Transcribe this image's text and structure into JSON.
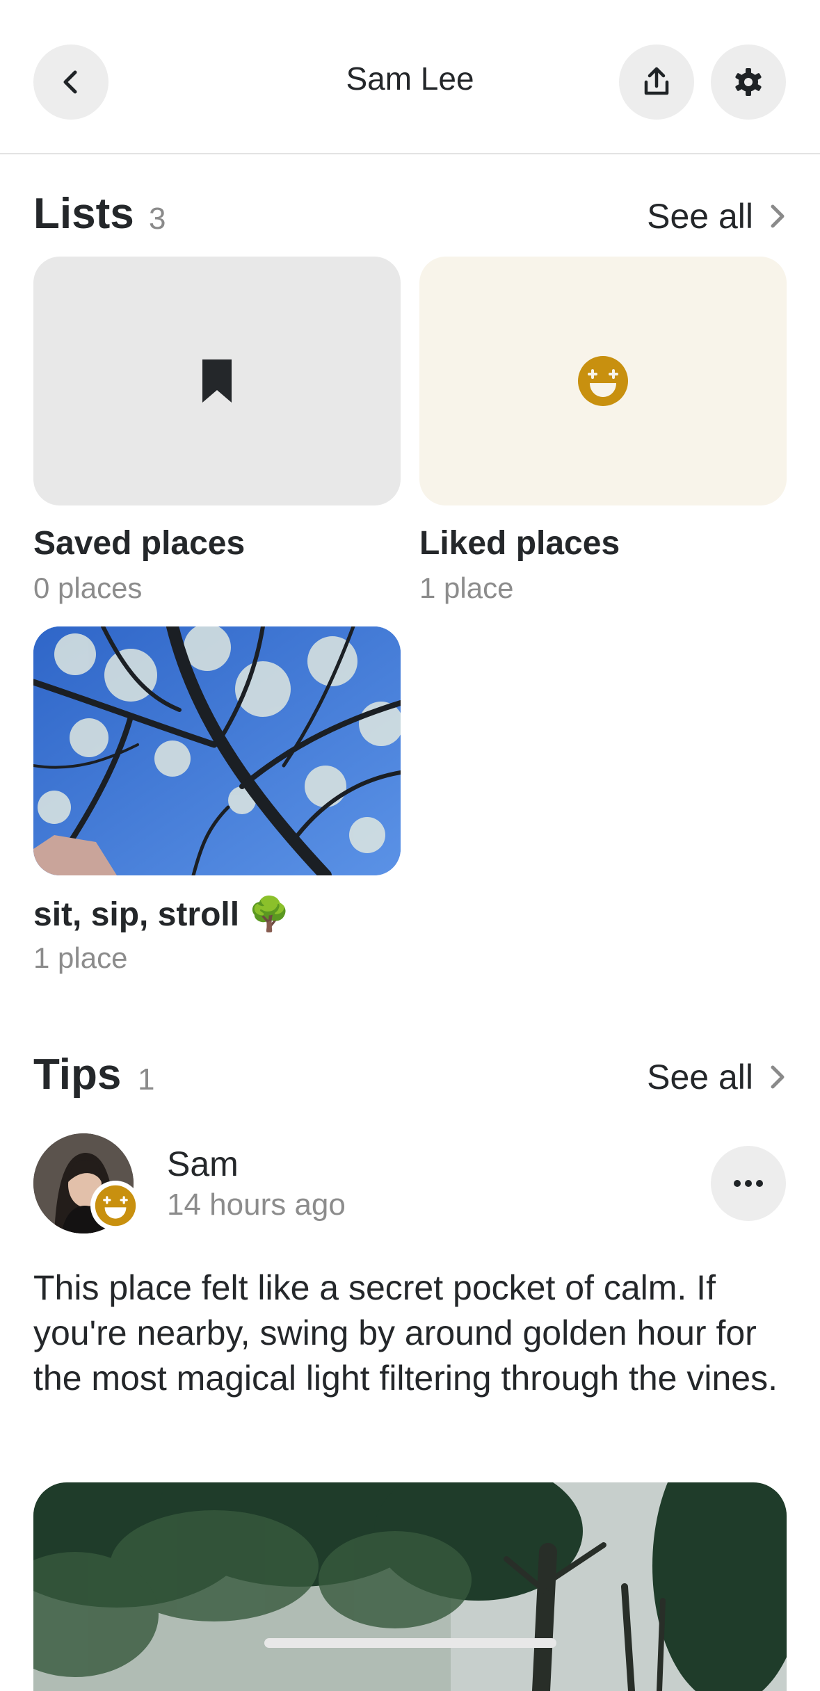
{
  "header": {
    "title": "Sam Lee"
  },
  "lists": {
    "title": "Lists",
    "count": "3",
    "see_all": "See all",
    "items": [
      {
        "name": "Saved places",
        "count": "0 places",
        "icon": "bookmark-icon"
      },
      {
        "name": "Liked places",
        "count": "1 place",
        "icon": "smiley-icon"
      },
      {
        "name": "sit, sip, stroll 🌳",
        "count": "1 place",
        "icon": "tree-photo"
      }
    ]
  },
  "tips": {
    "title": "Tips",
    "count": "1",
    "see_all": "See all",
    "tip": {
      "author": "Sam",
      "time": "14 hours ago",
      "body": "This place felt like a secret pocket of calm. If you're nearby, swing by around golden hour for the most magical light filtering through the vines."
    }
  },
  "colors": {
    "accent_gold": "#C8900F",
    "liked_bg": "#F8F4EA",
    "saved_bg": "#E8E8E8",
    "sky_blue": "#3C78D8"
  }
}
